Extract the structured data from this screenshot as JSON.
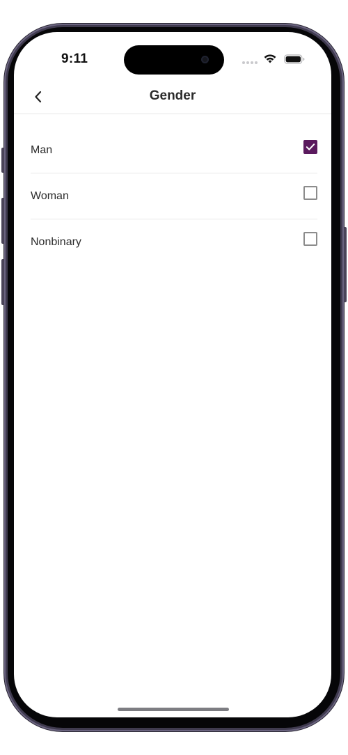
{
  "status_bar": {
    "time": "9:11"
  },
  "header": {
    "title": "Gender",
    "back_icon": "chevron-left-icon"
  },
  "options": [
    {
      "label": "Man",
      "checked": true
    },
    {
      "label": "Woman",
      "checked": false
    },
    {
      "label": "Nonbinary",
      "checked": false
    }
  ],
  "colors": {
    "accent": "#5b1a5e",
    "checkbox_border": "#8c8c8c",
    "text": "#2b2b2b",
    "divider": "#e8e8e8"
  }
}
